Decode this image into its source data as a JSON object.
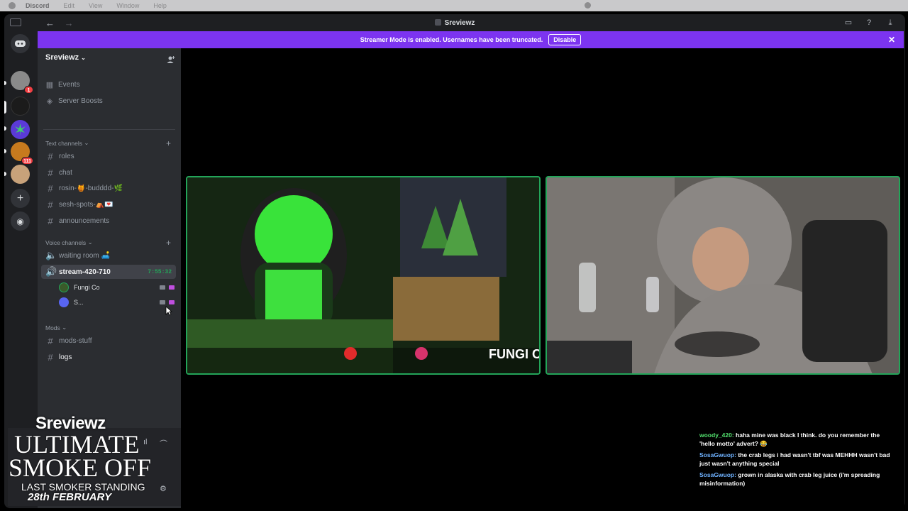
{
  "menubar": {
    "app": "Discord",
    "items": [
      "Edit",
      "View",
      "Window",
      "Help"
    ]
  },
  "window": {
    "title": "Sreviewz",
    "back": "←",
    "forward": "→"
  },
  "banner": {
    "text": "Streamer Mode is enabled. Usernames have been truncated.",
    "button": "Disable"
  },
  "rail": {
    "badges": [
      "1",
      "111"
    ]
  },
  "sidebar": {
    "server_name": "Sreviewz",
    "top_items": [
      {
        "label": "Events"
      },
      {
        "label": "Server Boosts"
      }
    ],
    "text_category": "Text channels",
    "text_channels": [
      "roles",
      "chat",
      "rosin-🍯-budddd-🌿",
      "sesh-spots-⛺️💌",
      "announcements"
    ],
    "voice_category": "Voice channels",
    "voice_channels": [
      {
        "name": "waiting room 🛋️"
      },
      {
        "name": "stream-420-710",
        "timer": "7:55:32"
      }
    ],
    "voice_users": [
      "Fungi Co",
      "S..."
    ],
    "mods_category": "Mods",
    "mods_channels": [
      "mods-stuff",
      "logs"
    ]
  },
  "overlay": {
    "name": "Sreviewz",
    "line1": "ULTIMATE",
    "line2": "SMOKE OFF",
    "line3": "LAST SMOKER STANDING",
    "date": "28th FEBRUARY"
  },
  "stream_tiles": [
    {
      "label": "FUNGI CO"
    },
    {
      "label": ""
    }
  ],
  "chat": [
    {
      "name": "woody_420:",
      "text": "haha mine was black I think. do you remember the 'hello motto' advert? 😂"
    },
    {
      "name": "SosaGwuop:",
      "text": "the crab legs i had wasn't tbf was MEHHH wasn't bad just wasn't anything special"
    },
    {
      "name": "SosaGwuop:",
      "text": "grown in alaska with crab leg juice (i'm spreading misinformation)"
    }
  ],
  "colors": {
    "accent": "#7c34f0",
    "green": "#23a559",
    "bg": "#1e1f22",
    "sidebar": "#2b2d31"
  }
}
